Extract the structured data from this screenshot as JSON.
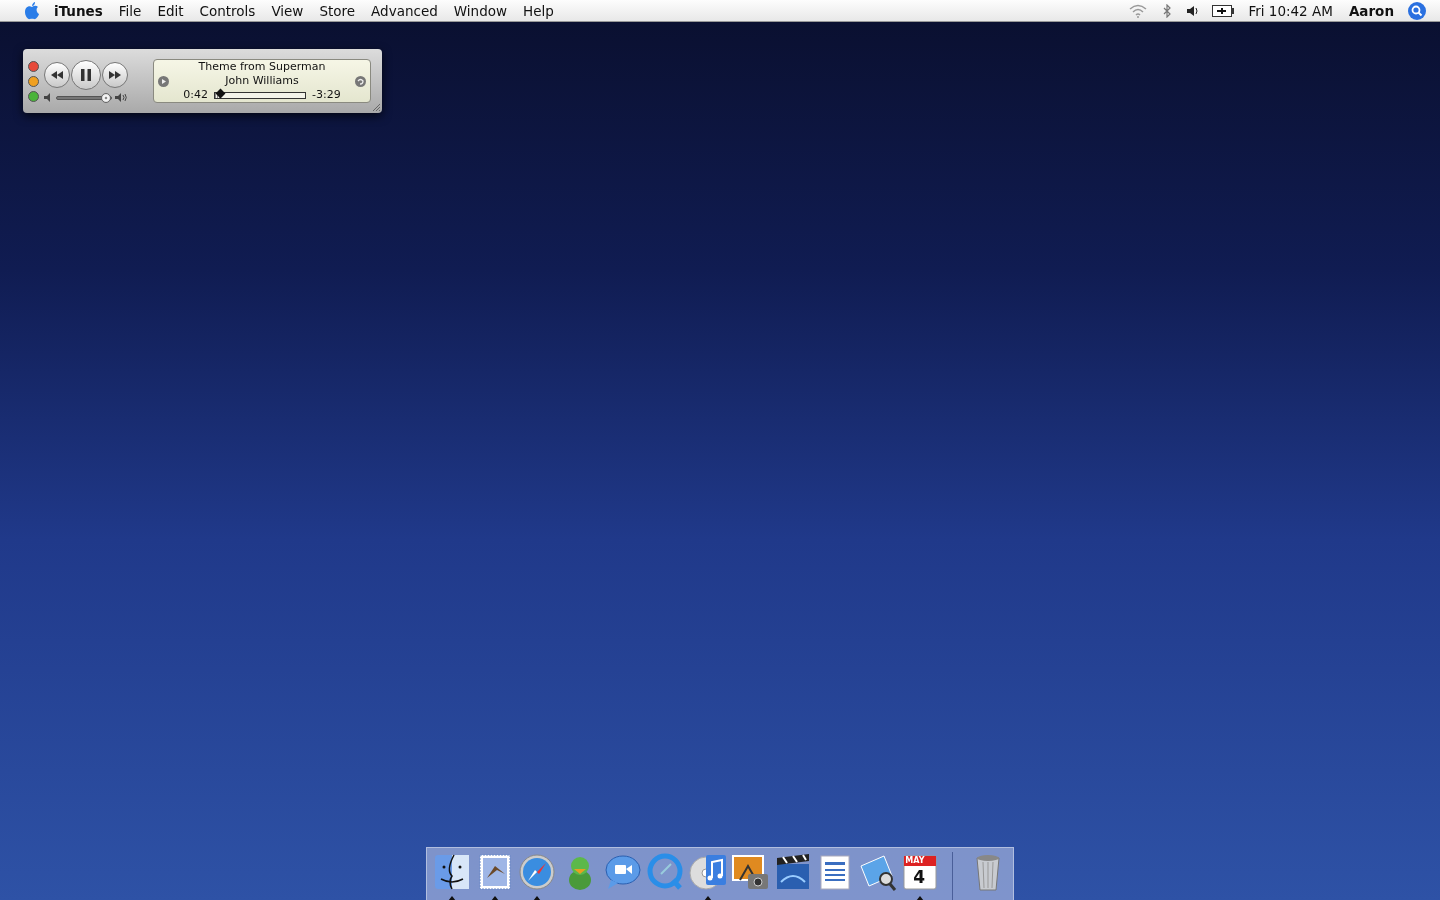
{
  "menu_bar": {
    "app_menu": "iTunes",
    "menus": [
      "File",
      "Edit",
      "Controls",
      "View",
      "Store",
      "Advanced",
      "Window",
      "Help"
    ],
    "clock": "Fri 10:42 AM",
    "user": "Aaron"
  },
  "mini_player": {
    "playing": true,
    "title": "Theme from Superman",
    "artist": "John Williams",
    "elapsed": "0:42",
    "remaining": "-3:29",
    "progress": {
      "level": 0.06
    },
    "volume": {
      "level": 0.9
    }
  },
  "dock": {
    "apps": [
      {
        "kind": "finder",
        "running": true
      },
      {
        "kind": "mail",
        "running": true
      },
      {
        "kind": "safari",
        "running": true
      },
      {
        "kind": "chat-buddy",
        "running": false
      },
      {
        "kind": "video-chat",
        "running": false
      },
      {
        "kind": "quicktime",
        "running": false
      },
      {
        "kind": "music",
        "running": true
      },
      {
        "kind": "photos",
        "running": false
      },
      {
        "kind": "movie",
        "running": false
      },
      {
        "kind": "word",
        "running": false
      },
      {
        "kind": "preview",
        "running": false
      },
      {
        "kind": "calendar",
        "running": true,
        "month": "MAY",
        "day": "4"
      }
    ]
  }
}
